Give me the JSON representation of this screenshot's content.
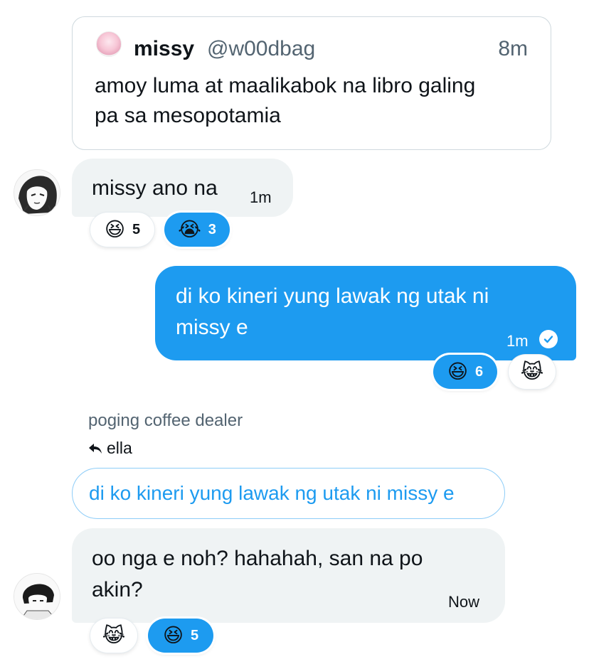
{
  "quoted_tweet": {
    "name": "missy",
    "handle": "@w00dbag",
    "time": "8m",
    "text_line1": "amoy luma at maalikabok na libro galing",
    "text_line2": "pa sa mesopotamia"
  },
  "messages": [
    {
      "direction": "incoming",
      "text": "missy ano na",
      "time": "1m",
      "reactions": [
        {
          "emoji": "😆",
          "count": "5",
          "active": false
        },
        {
          "emoji": "😭",
          "count": "3",
          "active": true
        }
      ]
    },
    {
      "direction": "outgoing",
      "text_line1": "di ko kineri yung lawak ng utak ni",
      "text_line2": "missy e",
      "time": "1m",
      "reactions": [
        {
          "emoji": "😆",
          "count": "6",
          "active": true
        },
        {
          "emoji": "😹",
          "count": "",
          "active": false
        }
      ]
    },
    {
      "direction": "incoming",
      "sender_name": "poging coffee dealer",
      "reply_icon": "reply-arrow-icon",
      "reply_to": "ella",
      "reply_quote": "di ko kineri yung lawak ng utak ni missy e",
      "text_line1": "oo nga e noh? hahahah, san na po",
      "text_line2": "akin?",
      "time": "Now",
      "reactions": [
        {
          "emoji": "😹",
          "count": "",
          "active": false
        },
        {
          "emoji": "😆",
          "count": "5",
          "active": true
        }
      ]
    }
  ],
  "colors": {
    "accent": "#1d9bf0",
    "incoming_bubble": "#eff3f4",
    "secondary_text": "#536471"
  }
}
